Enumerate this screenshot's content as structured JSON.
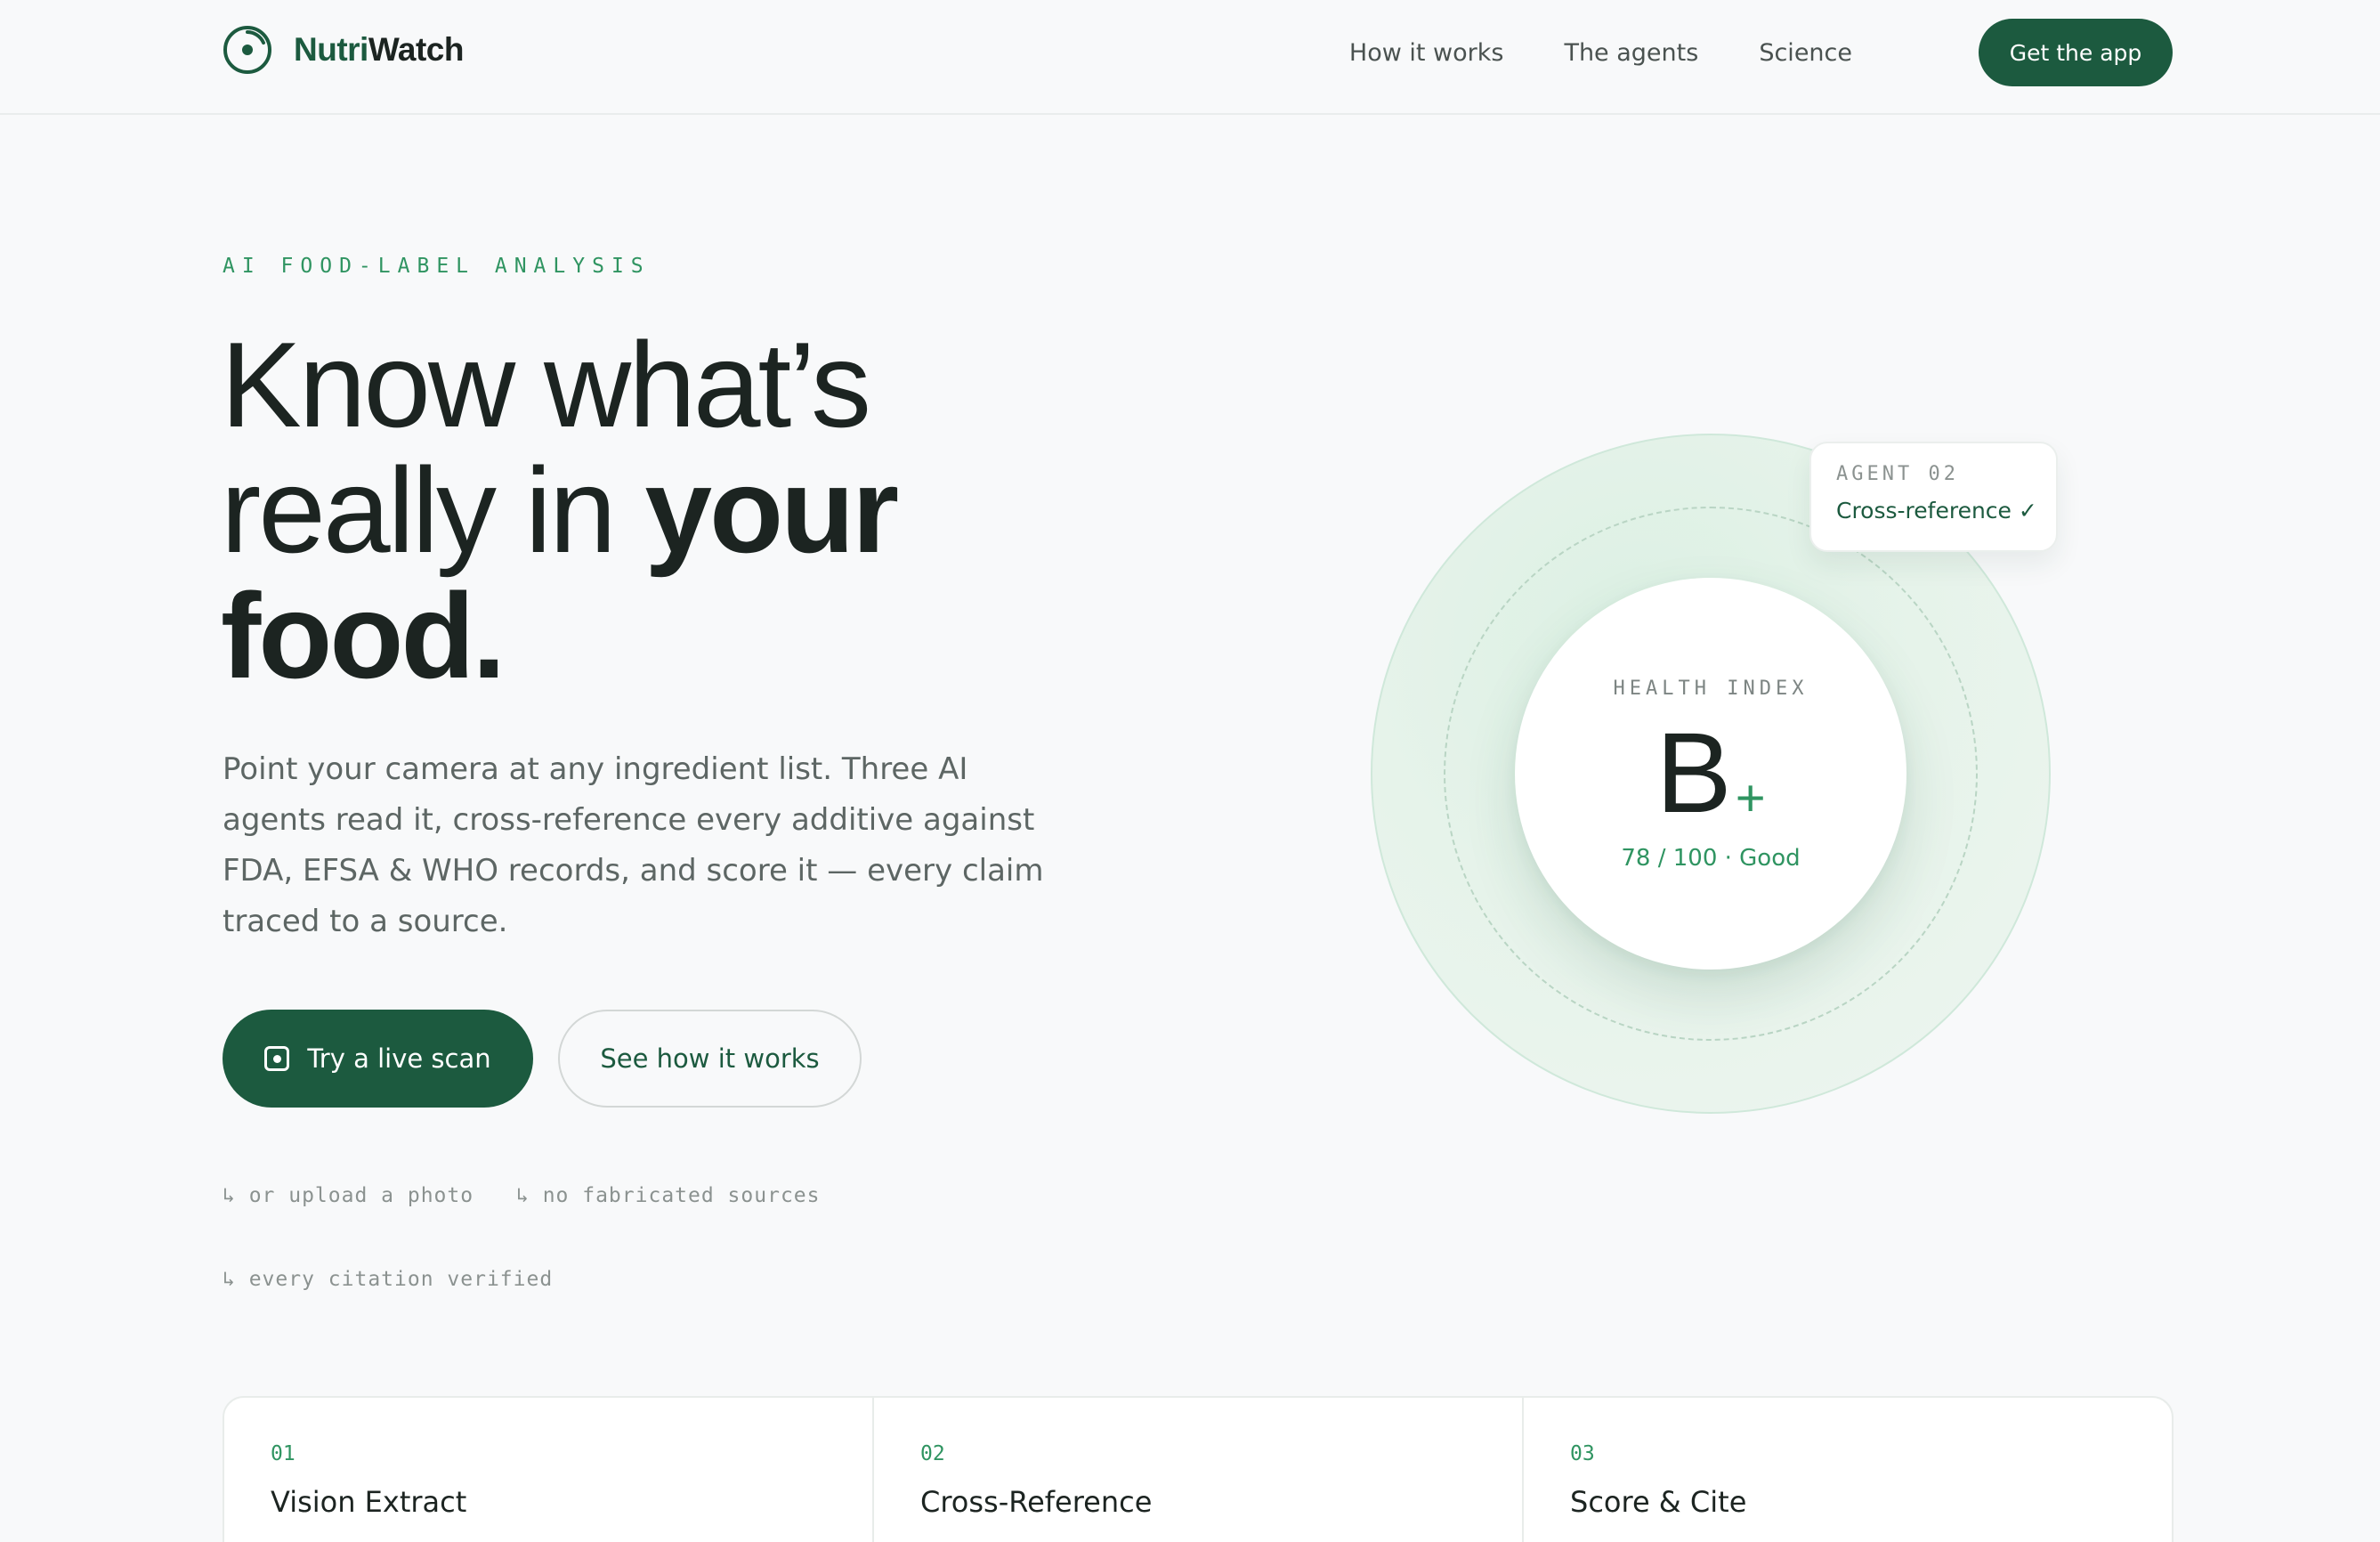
{
  "nav": {
    "brand_prefix": "Nutri",
    "brand_suffix": "Watch",
    "links": [
      "How it works",
      "The agents",
      "Science"
    ],
    "cta": "Get the app"
  },
  "hero": {
    "eyebrow": "AI FOOD-LABEL ANALYSIS",
    "headline": {
      "line1": "Know what’s",
      "line2_regular": "really in ",
      "line2_bold": "your",
      "line3_bold": "food."
    },
    "lede": "Point your camera at any ingredient list. Three AI agents read it, cross-reference every additive against FDA, EFSA & WHO records, and score it — every claim traced to a source.",
    "primary_button": "Try a live scan",
    "secondary_button": "See how it works",
    "notes": [
      "↳ or upload a photo",
      "↳ no fabricated sources",
      "↳ every citation verified"
    ]
  },
  "score": {
    "label": "HEALTH INDEX",
    "grade": "B",
    "modifier": "+",
    "summary": "78 / 100 · Good",
    "value": 78,
    "max": 100
  },
  "agent_card": {
    "tag": "AGENT 02",
    "name": "Cross-reference ✓"
  },
  "steps": [
    {
      "num": "01",
      "title": "Vision Extract"
    },
    {
      "num": "02",
      "title": "Cross-Reference"
    },
    {
      "num": "03",
      "title": "Score & Cite"
    }
  ],
  "colors": {
    "brand": "#1c5a3f",
    "accent": "#2f9461",
    "background": "#f8f9fa"
  },
  "icons": {
    "brand": "target-dot-icon",
    "scan": "camera-scan-icon"
  }
}
